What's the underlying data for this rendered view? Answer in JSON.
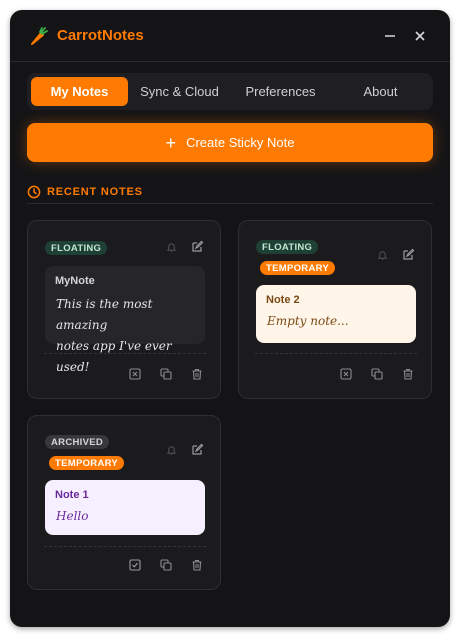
{
  "app": {
    "title": "CarrotNotes",
    "accent_color": "#ff7a00"
  },
  "tabs": [
    {
      "label": "My Notes",
      "active": true
    },
    {
      "label": "Sync & Cloud",
      "active": false
    },
    {
      "label": "Preferences",
      "active": false
    },
    {
      "label": "About",
      "active": false
    }
  ],
  "create_button": {
    "label": "Create Sticky Note"
  },
  "recent": {
    "header": "RECENT NOTES"
  },
  "cards": [
    {
      "status_badge": "FLOATING",
      "note": {
        "title": "MyNote",
        "body_line1": "This is the most amazing",
        "body_line2": "notes app I've ever used!",
        "background": "#26262a"
      }
    },
    {
      "status_badge": "FLOATING",
      "type_badge": "TEMPORARY",
      "note": {
        "title": "Note 2",
        "body_line1": "Empty note...",
        "background": "#fff5e8"
      }
    },
    {
      "status_badge": "ARCHIVED",
      "type_badge": "TEMPORARY",
      "note": {
        "title": "Note 1",
        "body_line1": "Hello",
        "background": "#f6efff"
      }
    }
  ]
}
